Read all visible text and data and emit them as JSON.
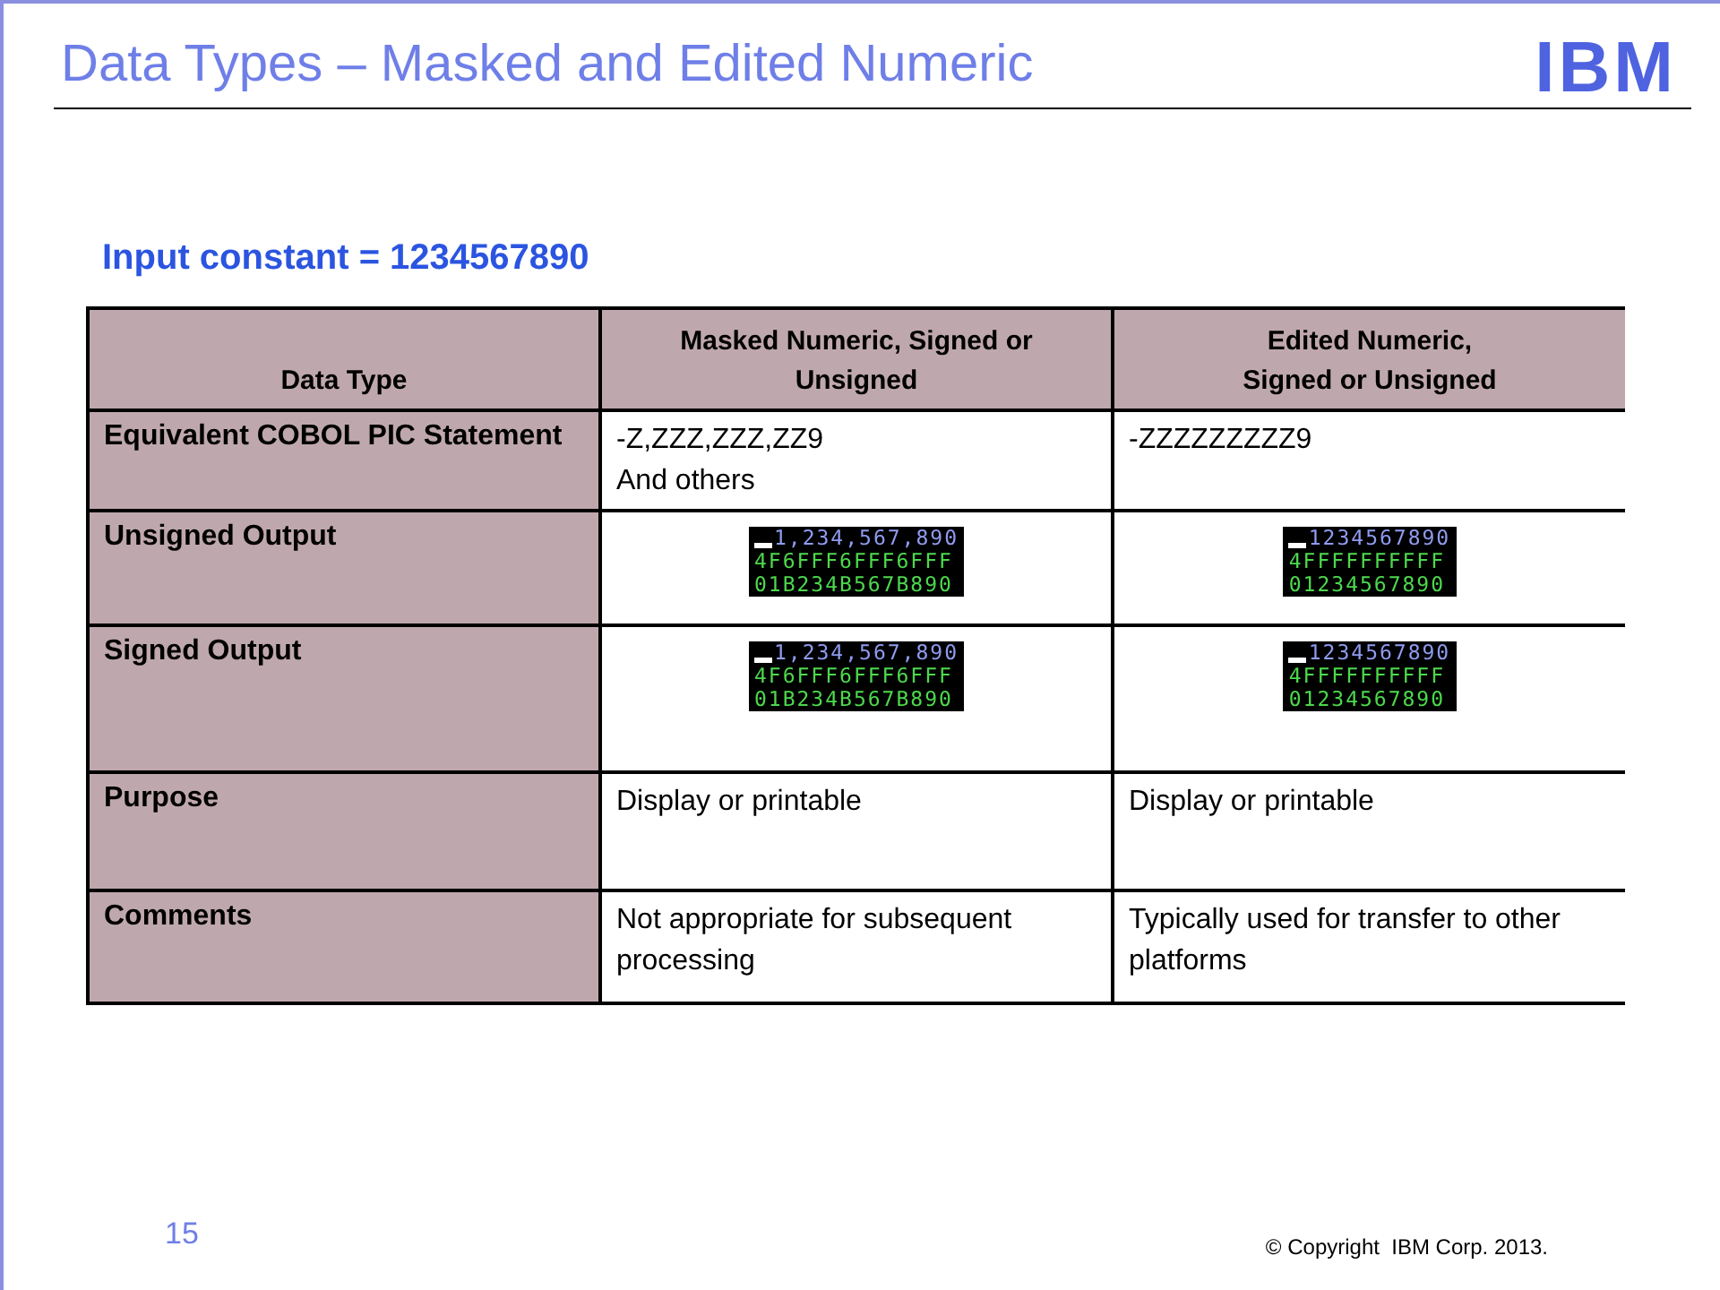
{
  "slide": {
    "title": "Data Types – Masked and Edited Numeric",
    "logo": "IBM",
    "subtitle": "Input constant = 1234567890",
    "page_number": "15",
    "copyright": "© Copyright  IBM Corp. 2013."
  },
  "table": {
    "columns": [
      "Data Type",
      "Masked Numeric, Signed or Unsigned",
      "Edited Numeric,\nSigned or Unsigned"
    ],
    "rows": [
      {
        "cells": [
          {
            "kind": "label",
            "text": "Equivalent COBOL PIC Statement"
          },
          {
            "kind": "text",
            "text": "-Z,ZZZ,ZZZ,ZZ9\nAnd others"
          },
          {
            "kind": "text",
            "text": "-ZZZZZZZZZ9"
          }
        ]
      },
      {
        "cells": [
          {
            "kind": "label",
            "text": "Unsigned Output"
          },
          {
            "kind": "screen",
            "lines": [
              {
                "text": "1,234,567,890",
                "color": "#8f9bf0"
              },
              {
                "text": "4F6FFF6FFF6FFF",
                "color": "#4cd84c"
              },
              {
                "text": "01B234B567B890",
                "color": "#4cd84c"
              }
            ]
          },
          {
            "kind": "screen",
            "lines": [
              {
                "text": "1234567890",
                "color": "#8f9bf0"
              },
              {
                "text": "4FFFFFFFFFF",
                "color": "#4cd84c"
              },
              {
                "text": "01234567890",
                "color": "#4cd84c"
              }
            ]
          }
        ]
      },
      {
        "cells": [
          {
            "kind": "label",
            "text": "Signed Output"
          },
          {
            "kind": "screen",
            "lines": [
              {
                "text": "1,234,567,890",
                "color": "#8f9bf0"
              },
              {
                "text": "4F6FFF6FFF6FFF",
                "color": "#4cd84c"
              },
              {
                "text": "01B234B567B890",
                "color": "#4cd84c"
              }
            ]
          },
          {
            "kind": "screen",
            "lines": [
              {
                "text": "1234567890",
                "color": "#8f9bf0"
              },
              {
                "text": "4FFFFFFFFFF",
                "color": "#4cd84c"
              },
              {
                "text": "01234567890",
                "color": "#4cd84c"
              }
            ]
          }
        ]
      },
      {
        "cells": [
          {
            "kind": "label",
            "text": "Purpose"
          },
          {
            "kind": "text",
            "text": "Display or printable"
          },
          {
            "kind": "text",
            "text": "Display or printable"
          }
        ]
      },
      {
        "cells": [
          {
            "kind": "label",
            "text": "Comments"
          },
          {
            "kind": "text",
            "text": "Not appropriate for subsequent processing"
          },
          {
            "kind": "text",
            "text": "Typically used for transfer to other platforms"
          }
        ]
      }
    ]
  }
}
